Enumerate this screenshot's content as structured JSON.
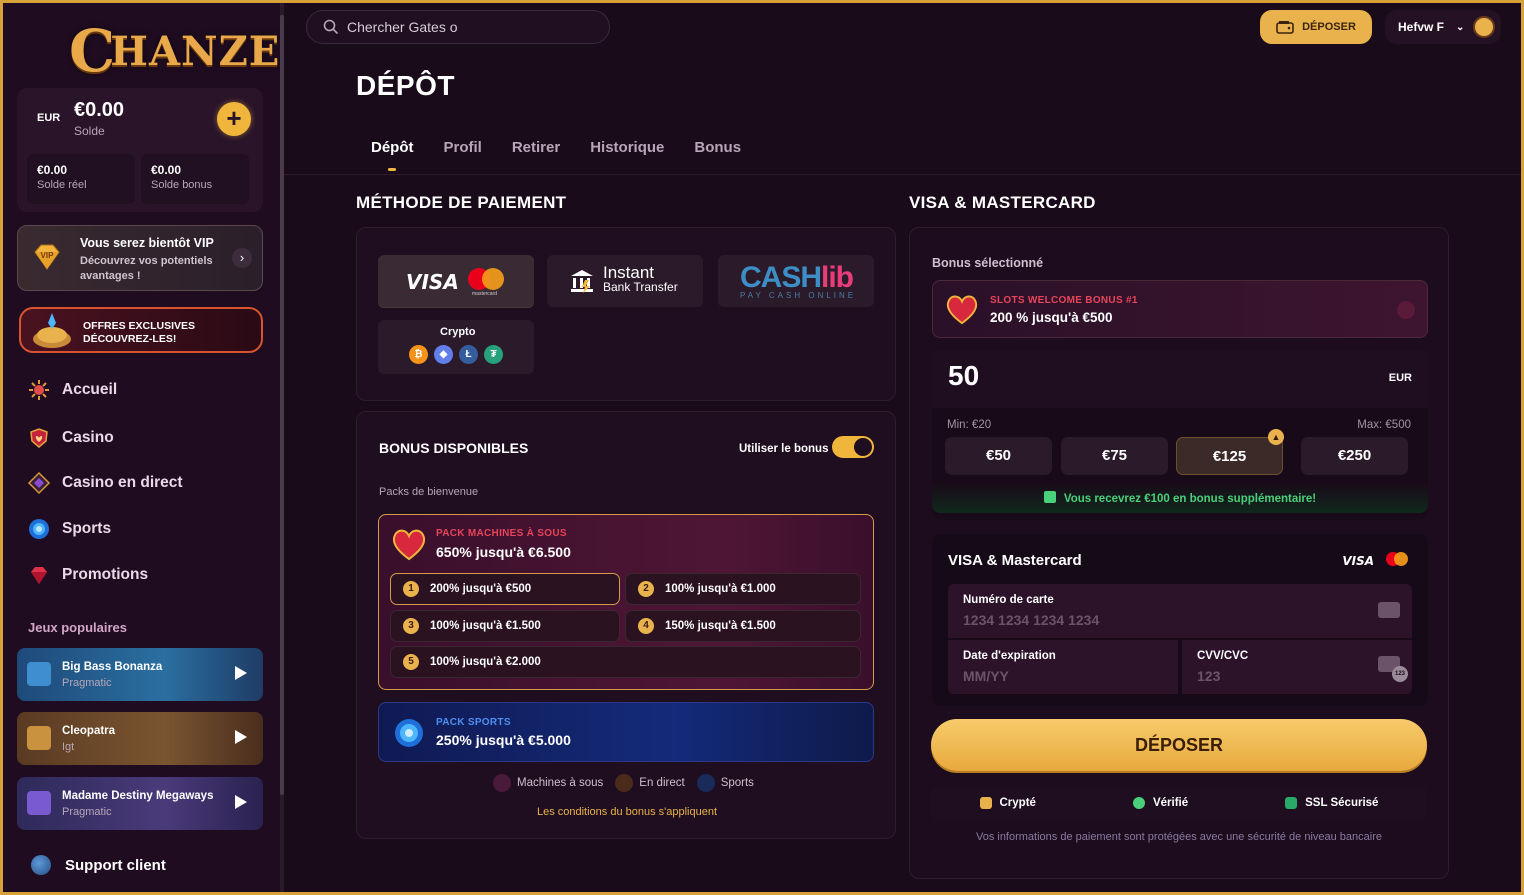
{
  "brand": "CHANZE",
  "wallet": {
    "currency": "EUR",
    "balance": "€0.00",
    "balance_label": "Solde",
    "real_value": "€0.00",
    "real_label": "Solde réel",
    "bonus_value": "€0.00",
    "bonus_label": "Solde bonus"
  },
  "vip": {
    "badge": "VIP",
    "title": "Vous serez bientôt VIP",
    "subtitle": "Découvrez vos potentiels avantages !"
  },
  "offers": {
    "line1": "OFFRES EXCLUSIVES",
    "line2": "DÉCOUVREZ-LES!"
  },
  "nav": [
    {
      "label": "Accueil",
      "icon": "home-icon"
    },
    {
      "label": "Casino",
      "icon": "casino-icon"
    },
    {
      "label": "Casino en direct",
      "icon": "live-casino-icon"
    },
    {
      "label": "Sports",
      "icon": "sports-icon"
    },
    {
      "label": "Promotions",
      "icon": "promotions-icon"
    }
  ],
  "popular_title": "Jeux populaires",
  "games": [
    {
      "name": "Big Bass Bonanza",
      "provider": "Pragmatic"
    },
    {
      "name": "Cleopatra",
      "provider": "Igt"
    },
    {
      "name": "Madame Destiny Megaways",
      "provider": "Pragmatic"
    }
  ],
  "support": "Support client",
  "search": {
    "placeholder": "Chercher Gates o"
  },
  "header": {
    "deposit_label": "DÉPOSER",
    "username": "Hefvw F"
  },
  "page": {
    "title": "DÉPÔT",
    "tabs": [
      "Dépôt",
      "Profil",
      "Retirer",
      "Historique",
      "Bonus"
    ],
    "active_tab": "Dépôt"
  },
  "payment": {
    "heading": "MÉTHODE DE PAIEMENT",
    "methods": {
      "visa": "VISA",
      "mastercard_small": "mastercard",
      "instant_title": "Instant",
      "instant_sub": "Bank Transfer",
      "cashlib_a": "CASH",
      "cashlib_b": "lib",
      "cashlib_sub": "PAY CASH ONLINE",
      "crypto": "Crypto"
    },
    "coins": [
      {
        "symbol": "₿",
        "color": "#f7931a"
      },
      {
        "symbol": "◆",
        "color": "#627eea"
      },
      {
        "symbol": "Ł",
        "color": "#345d9d"
      },
      {
        "symbol": "₮",
        "color": "#26a17b"
      }
    ]
  },
  "bonuses": {
    "heading": "BONUS DISPONIBLES",
    "use_label": "Utiliser le bonus",
    "use_on": true,
    "section_label": "Packs de bienvenue",
    "slots_pack": {
      "tag": "PACK MACHINES À SOUS",
      "title": "650% jusqu'à €6.500"
    },
    "tiers": [
      {
        "n": "1",
        "label": "200% jusqu'à €500"
      },
      {
        "n": "2",
        "label": "100% jusqu'à €1.000"
      },
      {
        "n": "3",
        "label": "100% jusqu'à €1.500"
      },
      {
        "n": "4",
        "label": "150% jusqu'à €1.500"
      },
      {
        "n": "5",
        "label": "100% jusqu'à €2.000"
      }
    ],
    "sports_pack": {
      "tag": "PACK SPORTS",
      "title": "250% jusqu'à €5.000"
    },
    "filters": [
      "Machines à sous",
      "En direct",
      "Sports"
    ],
    "terms": "Les conditions du bonus s'appliquent"
  },
  "card_panel": {
    "heading": "VISA & MASTERCARD",
    "selected_label": "Bonus sélectionné",
    "selected_tag": "SLOTS WELCOME BONUS #1",
    "selected_title": "200 % jusqu'à €500",
    "amount": "50",
    "currency": "EUR",
    "min": "Min: €20",
    "max": "Max: €500",
    "quick": [
      "€50",
      "€75",
      "€125",
      "€250"
    ],
    "quick_selected": "€125",
    "extra": "Vous recevrez €100 en bonus supplémentaire!",
    "form_title": "VISA & Mastercard",
    "form_visa": "VISA",
    "card_number_label": "Numéro de carte",
    "card_number_placeholder": "1234 1234 1234 1234",
    "expiry_label": "Date d'expiration",
    "expiry_placeholder": "MM/YY",
    "cvv_label": "CVV/CVC",
    "cvv_placeholder": "123",
    "cvv_badge": "123",
    "submit": "DÉPOSER",
    "trust": [
      "Crypté",
      "Vérifié",
      "SSL Sécurisé"
    ],
    "secure_note": "Vos informations de paiement sont protégées avec une sécurité de niveau bancaire"
  }
}
